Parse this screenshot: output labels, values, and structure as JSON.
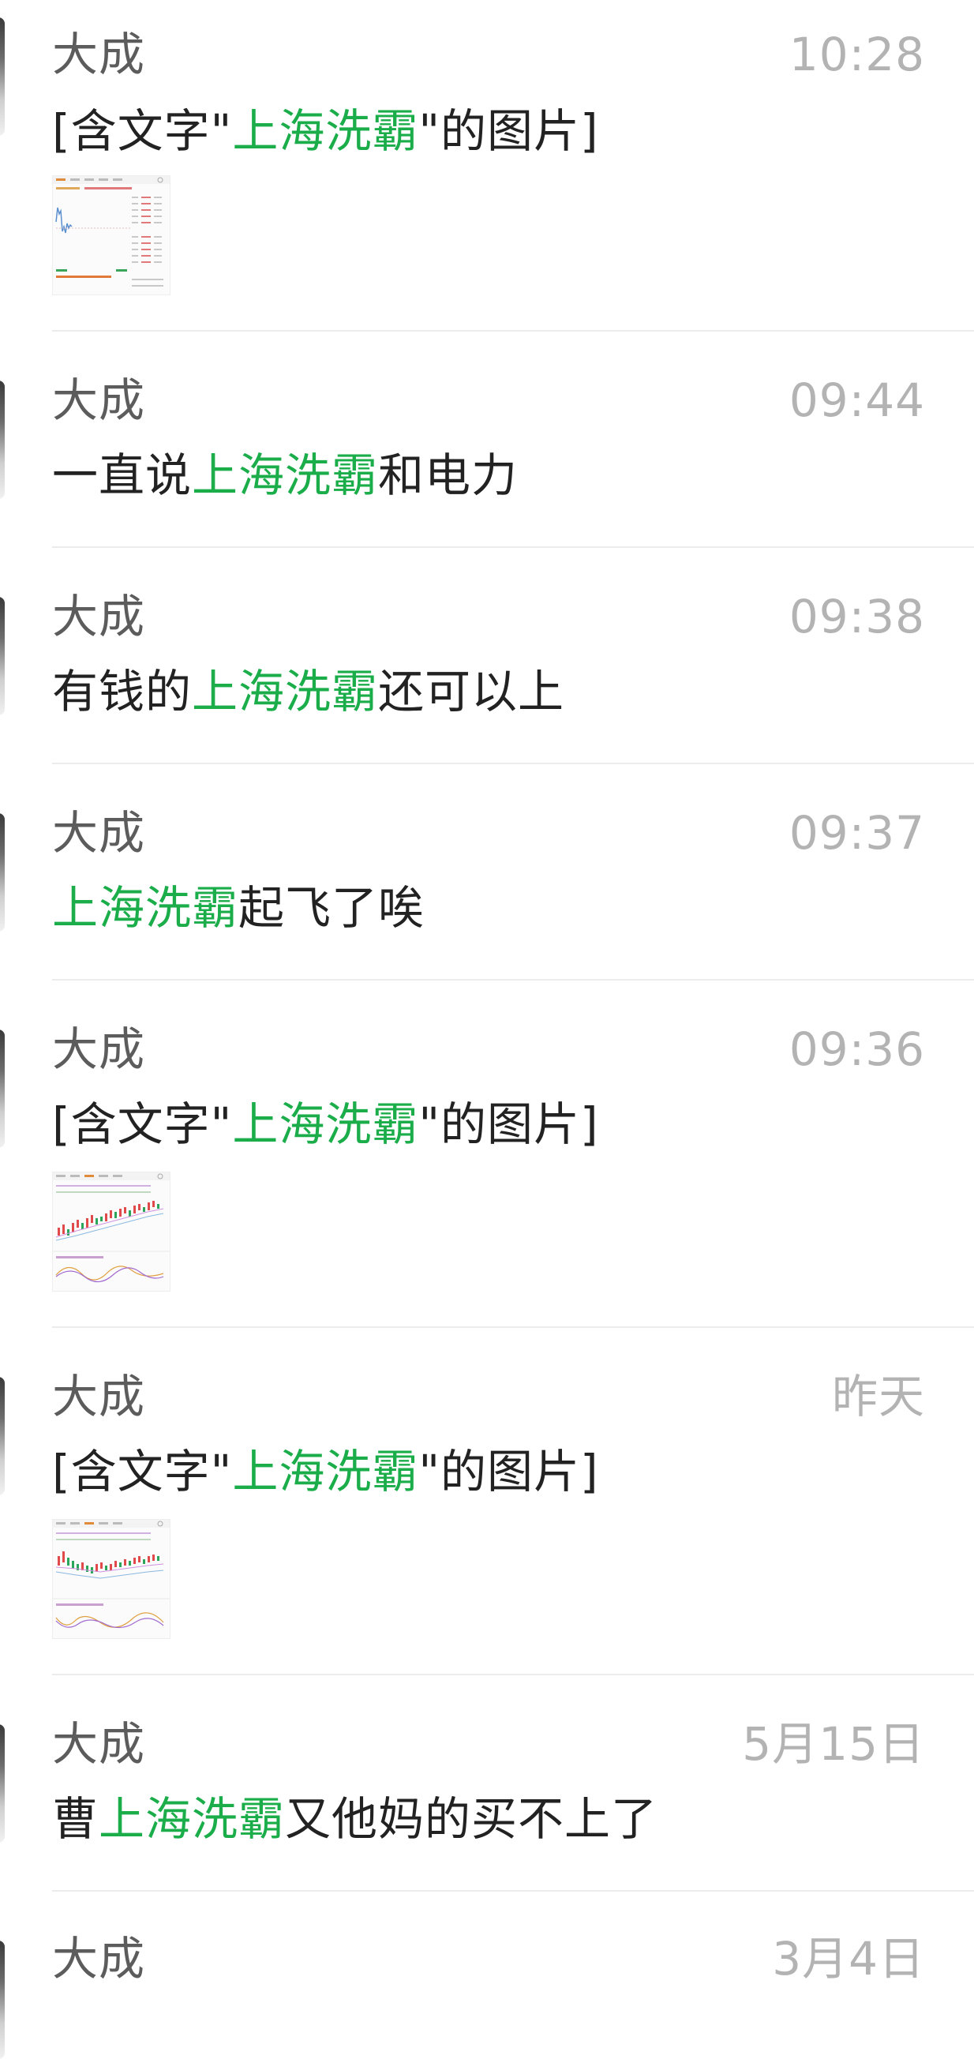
{
  "results": [
    {
      "sender": "大成",
      "time": "10:28",
      "message": {
        "before": "[含文字\"",
        "keyword": "上海洗霸",
        "after": "\"的图片]"
      },
      "has_image": true,
      "image_type": "intraday-chart"
    },
    {
      "sender": "大成",
      "time": "09:44",
      "message": {
        "before": "一直说",
        "keyword": "上海洗霸",
        "after": "和电力"
      },
      "has_image": false
    },
    {
      "sender": "大成",
      "time": "09:38",
      "message": {
        "before": "有钱的",
        "keyword": "上海洗霸",
        "after": "还可以上"
      },
      "has_image": false
    },
    {
      "sender": "大成",
      "time": "09:37",
      "message": {
        "before": "",
        "keyword": "上海洗霸",
        "after": "起飞了唉"
      },
      "has_image": false
    },
    {
      "sender": "大成",
      "time": "09:36",
      "message": {
        "before": "[含文字\"",
        "keyword": "上海洗霸",
        "after": "\"的图片]"
      },
      "has_image": true,
      "image_type": "candlestick-chart"
    },
    {
      "sender": "大成",
      "time": "昨天",
      "message": {
        "before": "[含文字\"",
        "keyword": "上海洗霸",
        "after": "\"的图片]"
      },
      "has_image": true,
      "image_type": "candlestick-chart"
    },
    {
      "sender": "大成",
      "time": "5月15日",
      "message": {
        "before": "曹",
        "keyword": "上海洗霸",
        "after": "又他妈的买不上了"
      },
      "has_image": false
    },
    {
      "sender": "大成",
      "time": "3月4日",
      "message": {
        "before": "",
        "keyword": "",
        "after": ""
      },
      "has_image": false
    }
  ],
  "colors": {
    "keyword_highlight": "#1aad4a",
    "sender_text": "#5c5c5c",
    "time_text": "#b3b3b3",
    "message_text": "#222222",
    "divider": "#ececec"
  }
}
